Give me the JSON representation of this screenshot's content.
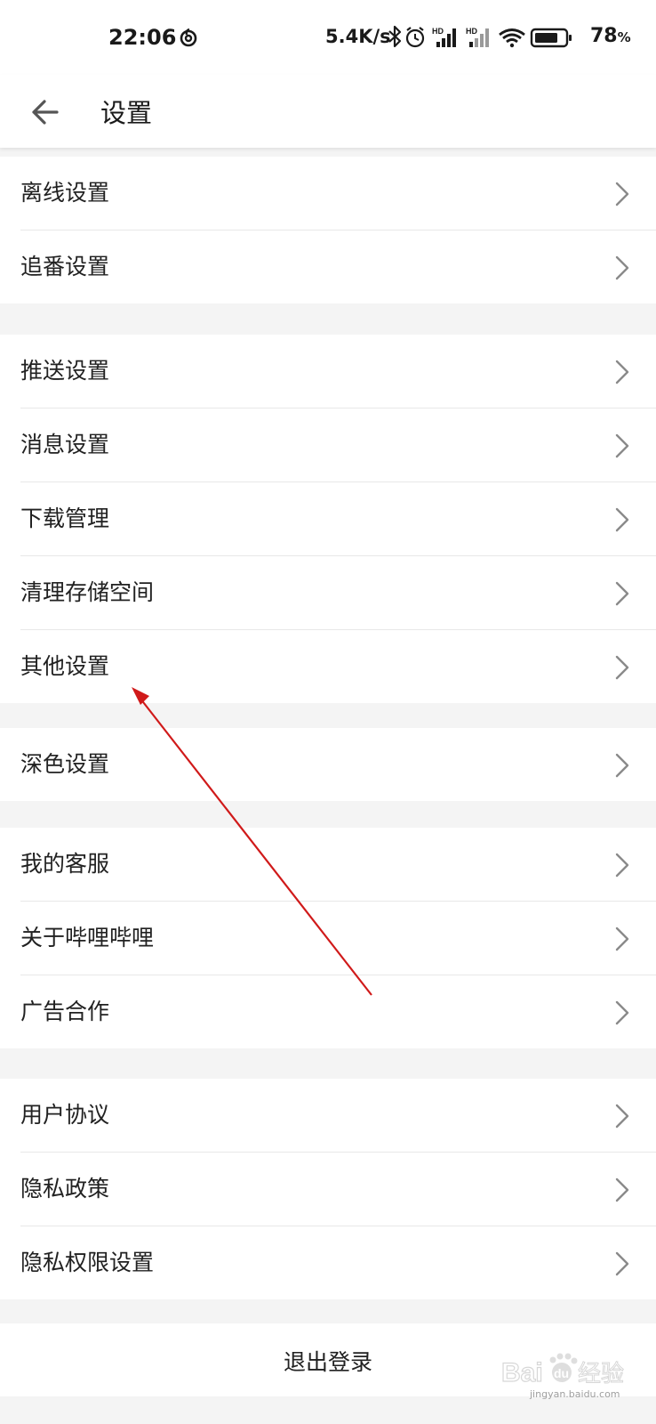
{
  "status_bar": {
    "time": "22:06",
    "net_speed": "5.4K/s",
    "battery_percent": "78",
    "battery_unit": "%",
    "battery_level": 0.78,
    "hd_label": "HD"
  },
  "header": {
    "title": "设置"
  },
  "groups": [
    {
      "items": [
        "离线设置",
        "追番设置"
      ]
    },
    {
      "items": [
        "推送设置",
        "消息设置",
        "下载管理",
        "清理存储空间",
        "其他设置"
      ]
    },
    {
      "items": [
        "深色设置"
      ]
    },
    {
      "items": [
        "我的客服",
        "关于哔哩哔哩",
        "广告合作"
      ]
    },
    {
      "items": [
        "用户协议",
        "隐私政策",
        "隐私权限设置"
      ]
    }
  ],
  "logout_label": "退出登录",
  "watermark": {
    "brand": "Bai",
    "paw": "du",
    "cn": "经验",
    "url": "jingyan.baidu.com"
  },
  "colors": {
    "annotation_arrow": "#d01a1a",
    "chevron": "#8a8a8a",
    "divider": "#e8e8e8",
    "group_gap": "#f4f4f4"
  },
  "icons": [
    "netease-music-icon",
    "bluetooth-icon",
    "alarm-icon",
    "signal-icon",
    "wifi-icon",
    "battery-icon",
    "back-arrow-icon",
    "chevron-right-icon"
  ]
}
